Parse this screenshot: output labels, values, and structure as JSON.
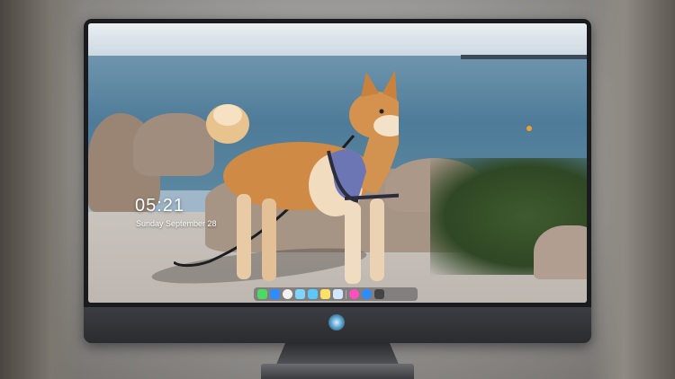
{
  "lockscreen": {
    "time": "05:21",
    "date": "Sunday September  28"
  },
  "dock": {
    "apps": [
      {
        "name": "messages-icon",
        "color": "#4cd964"
      },
      {
        "name": "mail-icon",
        "color": "#2f8cff"
      },
      {
        "name": "clock-icon",
        "color": "#f2f2f2"
      },
      {
        "name": "photos-icon",
        "color": "#7fd3ff"
      },
      {
        "name": "finalcut-icon",
        "color": "#5ac8fa"
      },
      {
        "name": "notes-icon",
        "color": "#ffe066"
      },
      {
        "name": "preview-icon",
        "color": "#cfe8ff"
      },
      {
        "name": "itunes-icon",
        "color": "#ff4fbf"
      },
      {
        "name": "appstore-icon",
        "color": "#2d8cff"
      },
      {
        "name": "terminal-icon",
        "color": "#444444"
      }
    ]
  }
}
